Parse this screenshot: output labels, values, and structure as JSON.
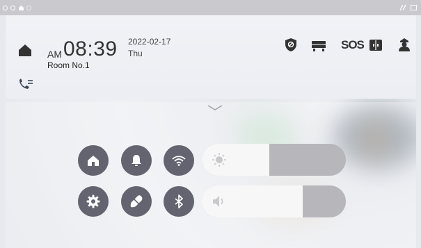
{
  "clock": {
    "ampm": "AM",
    "time": "08:39",
    "room": "Room No.1",
    "date": "2022-02-17",
    "weekday": "Thu"
  },
  "top_actions": {
    "sos_label": "SOS"
  },
  "sliders": {
    "brightness_level": 0.47,
    "volume_level": 0.7
  },
  "colors": {
    "button_bg": "#646470",
    "slider_track": "#b7b7bb",
    "slider_fill": "#f7f7f8"
  }
}
